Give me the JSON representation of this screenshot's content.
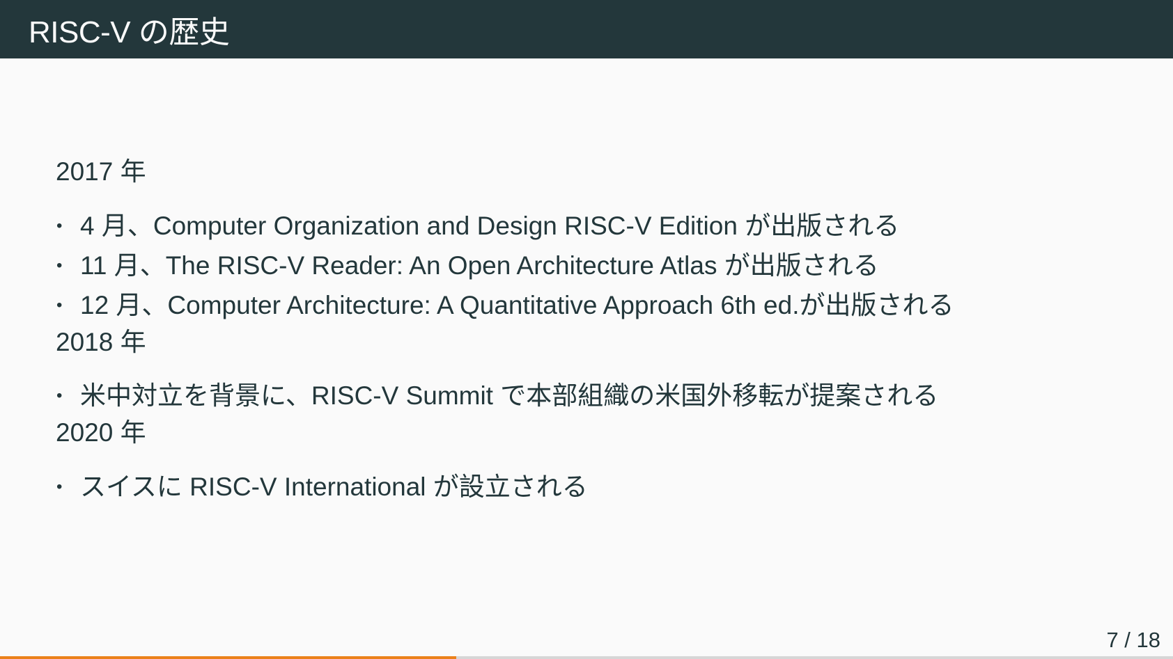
{
  "slide": {
    "title": "RISC-V の歴史",
    "sections": [
      {
        "year": "2017 年",
        "items": [
          "4 月、Computer Organization and Design RISC-V Edition が出版される",
          "11 月、The RISC-V Reader: An Open Architecture Atlas が出版される",
          "12 月、Computer Architecture: A Quantitative Approach 6th ed.が出版される"
        ]
      },
      {
        "year": "2018 年",
        "items": [
          "米中対立を背景に、RISC-V Summit で本部組織の米国外移転が提案される"
        ]
      },
      {
        "year": "2020 年",
        "items": [
          "スイスに RISC-V International が設立される"
        ]
      }
    ],
    "bullet_glyph": "•",
    "page_indicator": "7 / 18",
    "progress_fraction": 0.389
  },
  "colors": {
    "title_bar": "#23373b",
    "background": "#fafafa",
    "text": "#23373b",
    "progress_fill": "#eb811b",
    "progress_track": "#d6d6d6"
  }
}
